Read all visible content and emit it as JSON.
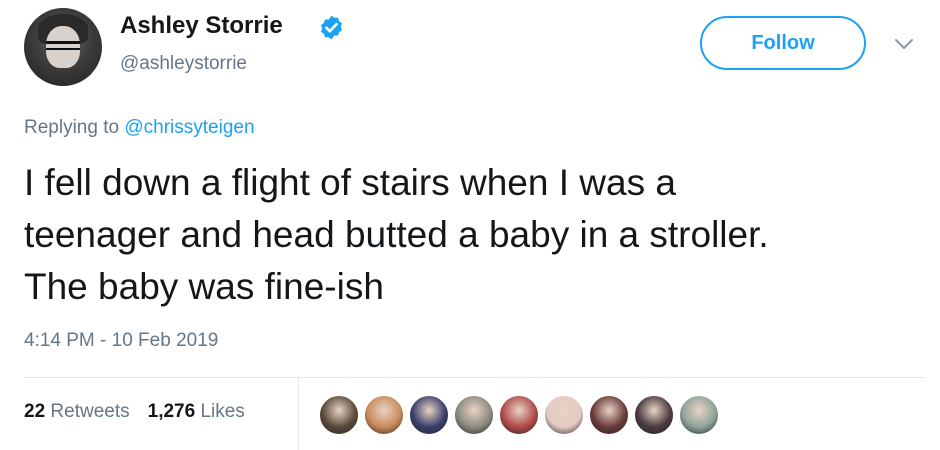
{
  "user": {
    "name": "Ashley Storrie",
    "handle": "@ashleystorrie",
    "verified": true
  },
  "follow_label": "Follow",
  "reply": {
    "prefix": "Replying to ",
    "to": "@chrissyteigen"
  },
  "tweet_lines": [
    "I fell down a flight of stairs when I was a",
    "teenager and head butted a baby in a stroller.",
    "The baby was fine-ish"
  ],
  "timestamp": "4:14 PM - 10 Feb 2019",
  "stats": {
    "retweets_count": "22",
    "retweets_label": "Retweets",
    "likes_count": "1,276",
    "likes_label": "Likes"
  },
  "colors": {
    "accent": "#1da1f2",
    "muted": "#657786",
    "text": "#14171a",
    "divider": "#e1e8ed"
  },
  "likers": [
    {
      "color": "#5b4a3a"
    },
    {
      "color": "#c98a5a"
    },
    {
      "color": "#3a3f6b"
    },
    {
      "color": "#8d8a80"
    },
    {
      "color": "#b04a4a"
    },
    {
      "color": "#e3cbc4"
    },
    {
      "color": "#6b3b3b"
    },
    {
      "color": "#4a3a40"
    },
    {
      "color": "#8fa39a"
    }
  ]
}
